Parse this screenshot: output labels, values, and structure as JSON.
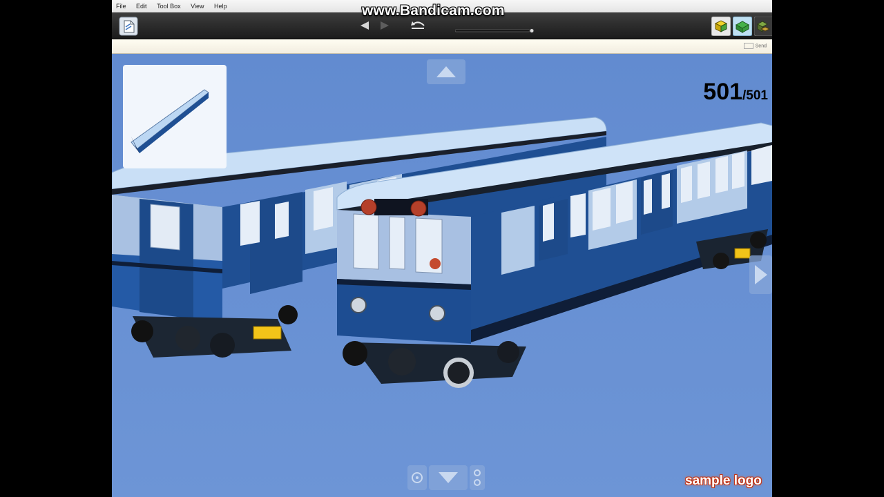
{
  "app": {
    "menu": [
      "File",
      "Edit",
      "Tool Box",
      "View",
      "Help"
    ],
    "send_label": "Send"
  },
  "overlays": {
    "recorder_watermark": "www.Bandicam.com",
    "sample_logo": "sample logo"
  },
  "step_counter": {
    "current": "501",
    "total": "/501"
  },
  "icons": {
    "new": "document-icon",
    "back": "step-back-icon",
    "forward": "step-forward-icon",
    "replay": "rotate-icon",
    "slider": "step-slider",
    "view_modes": [
      "build-mode-icon",
      "view-mode-icon",
      "ldd-mode-icon"
    ],
    "nav": [
      "arrow-up-icon",
      "arrow-down-icon",
      "arrow-right-icon",
      "zoom-icon",
      "camera-icon"
    ]
  },
  "colors": {
    "viewport": "#6a91cf",
    "train_body": "#1f4f93",
    "train_roof": "#c9dff6",
    "brand_watermark": "#ffffff",
    "logo_red": "#e0541e"
  },
  "step_progress": 1.0
}
